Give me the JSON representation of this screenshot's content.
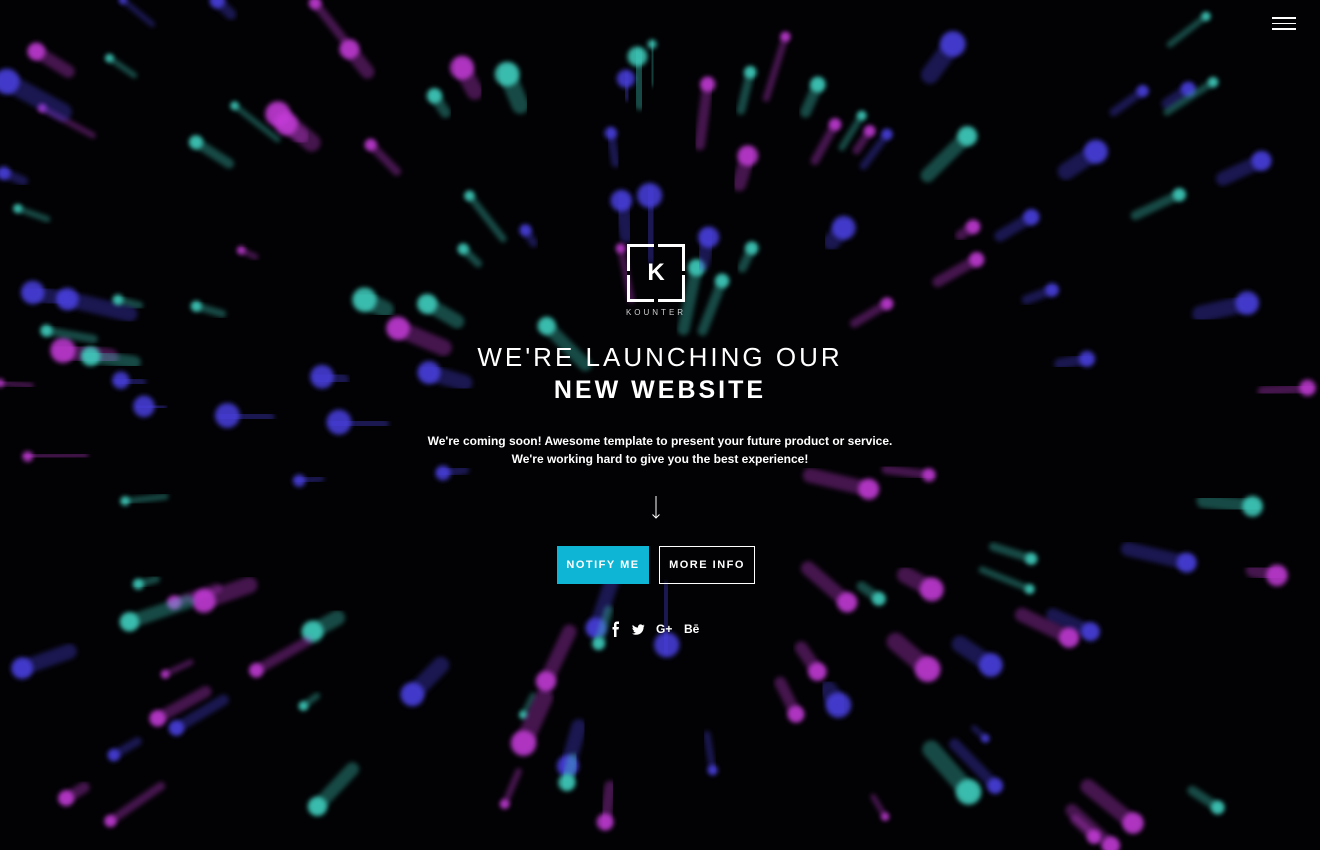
{
  "brand": {
    "logo_letter": "K",
    "name": "KOUNTER"
  },
  "menu": {
    "icon": "hamburger-menu-icon"
  },
  "hero": {
    "headline_line1": "WE'RE LAUNCHING OUR",
    "headline_line2": "NEW WEBSITE",
    "tagline_line1": "We're coming soon! Awesome template to present your future product or service.",
    "tagline_line2": "We're working hard to give you the best experience!",
    "scroll_icon": "arrow-down-icon"
  },
  "buttons": {
    "notify_label": "NOTIFY ME",
    "info_label": "MORE INFO"
  },
  "social": [
    {
      "name": "facebook",
      "icon": "facebook-icon"
    },
    {
      "name": "twitter",
      "icon": "twitter-icon"
    },
    {
      "name": "google-plus",
      "icon": "google-plus-icon",
      "text": "G+"
    },
    {
      "name": "behance",
      "icon": "behance-icon",
      "text": "Bē"
    }
  ],
  "colors": {
    "background": "#020204",
    "accent": "#0fb5d4",
    "particle_teal": "#3fd0c0",
    "particle_blue": "#4a3fe0",
    "particle_magenta": "#c23ad6"
  }
}
